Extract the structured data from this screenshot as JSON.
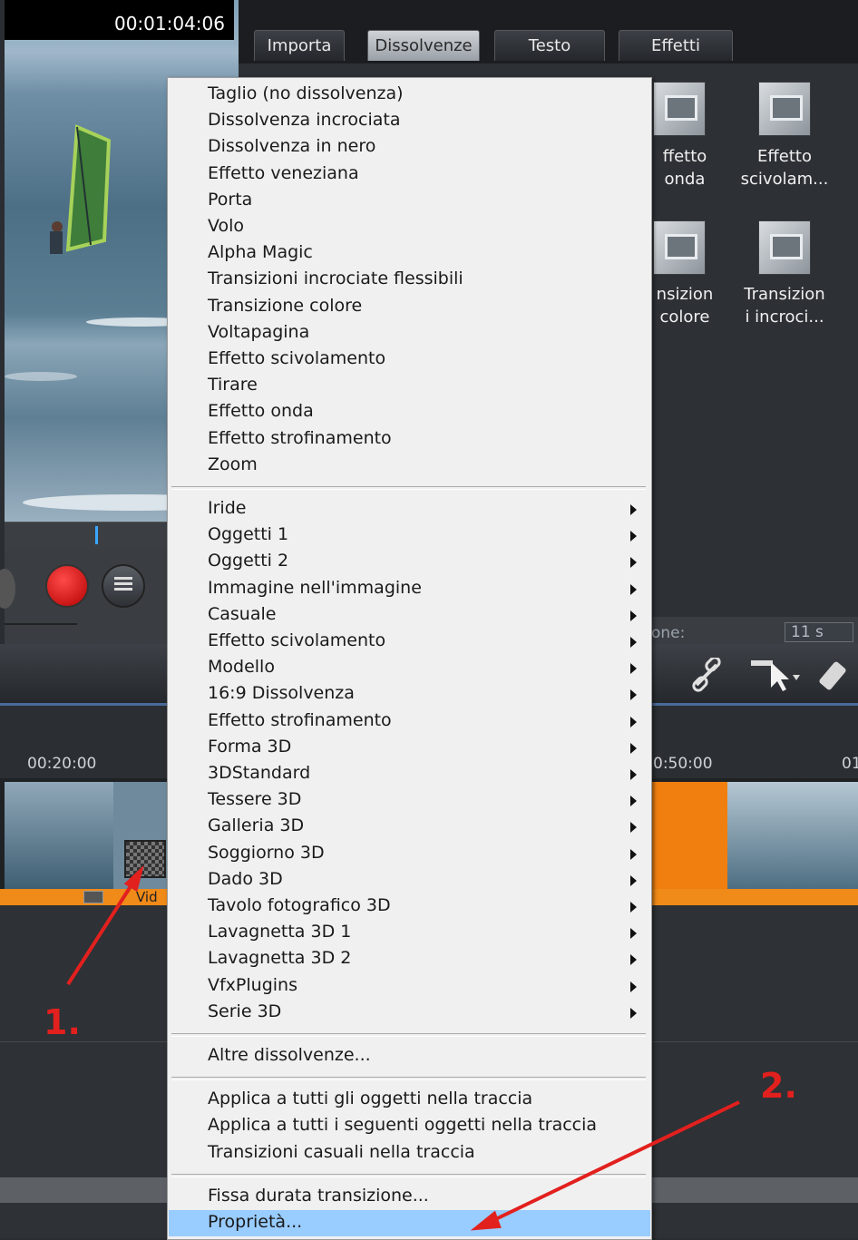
{
  "preview": {
    "timecode": "00:01:04:06"
  },
  "tabs": [
    {
      "label": "Importa",
      "active": false
    },
    {
      "label": "Dissolvenze",
      "active": true
    },
    {
      "label": "Testo",
      "active": false
    },
    {
      "label": "Effetti",
      "active": false
    }
  ],
  "fx_panel": {
    "items": [
      {
        "label": "ffetto\nonda"
      },
      {
        "label": "Effetto\nscivolam..."
      },
      {
        "label": "nsizion\ncolore"
      },
      {
        "label": "Transizion\ni incroci..."
      }
    ],
    "duration_label": "one:",
    "duration_value": "11 s"
  },
  "timeline": {
    "ruler_left": "00:20:00",
    "ruler_right": "0:50:00",
    "ruler_far": "01",
    "clip_label": "Vid"
  },
  "menu": {
    "group1": [
      "Taglio (no dissolvenza)",
      "Dissolvenza incrociata",
      "Dissolvenza in nero",
      "Effetto veneziana",
      "Porta",
      "Volo",
      "Alpha Magic",
      "Transizioni incrociate flessibili",
      "Transizione colore",
      "Voltapagina",
      "Effetto scivolamento",
      "Tirare",
      "Effetto onda",
      "Effetto strofinamento",
      "Zoom"
    ],
    "group2": [
      "Iride",
      "Oggetti 1",
      "Oggetti 2",
      "Immagine nell'immagine",
      "Casuale",
      "Effetto scivolamento",
      "Modello",
      "16:9 Dissolvenza",
      "Effetto strofinamento",
      "Forma 3D",
      "3DStandard",
      "Tessere 3D",
      "Galleria 3D",
      "Soggiorno 3D",
      "Dado 3D",
      "Tavolo fotografico 3D",
      "Lavagnetta 3D 1",
      "Lavagnetta 3D 2",
      "VfxPlugins",
      "Serie 3D"
    ],
    "group3": [
      "Altre dissolvenze..."
    ],
    "group4": [
      "Applica a tutti gli oggetti nella traccia",
      "Applica a tutti i seguenti oggetti nella traccia",
      "Transizioni casuali nella traccia"
    ],
    "group5": [
      "Fissa durata transizione...",
      "Proprietà..."
    ],
    "highlighted": "Proprietà..."
  },
  "annotations": {
    "step1": "1.",
    "step2": "2.",
    "color": "#e2201e"
  }
}
